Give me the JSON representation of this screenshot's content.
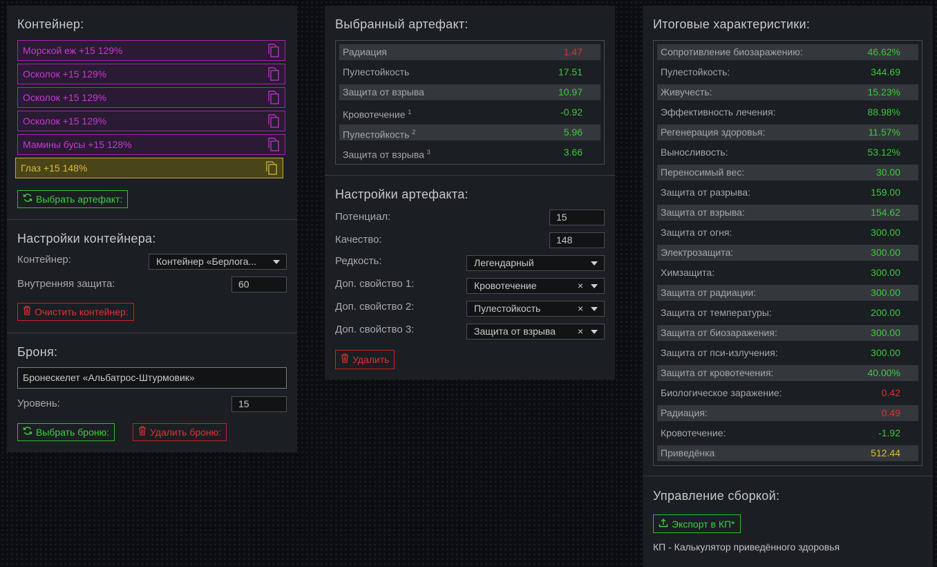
{
  "container": {
    "title": "Контейнер:",
    "slots": [
      "Морской еж +15 129%",
      "Осколок +15 129%",
      "Осколок +15 129%",
      "Осколок +15 129%",
      "Мамины бусы +15 128%"
    ],
    "gold_slot": "Глаз +15 148%",
    "select_artifact_label": "Выбрать артефакт:"
  },
  "container_settings": {
    "title": "Настройки контейнера:",
    "container_label": "Контейнер:",
    "container_value": "Контейнер «Берлога...",
    "inner_label": "Внутренняя защита:",
    "inner_value": "60",
    "clear_label": "Очистить контейнер:"
  },
  "armor": {
    "title": "Броня:",
    "name": "Бронескелет «Альбатрос-Штурмовик»",
    "level_label": "Уровень:",
    "level_value": "15",
    "choose_label": "Выбрать броню:",
    "delete_label": "Удалить броню:"
  },
  "selected": {
    "title": "Выбранный артефакт:",
    "rows": [
      {
        "name": "Радиация",
        "sup": "",
        "value": "1.47",
        "color": "red"
      },
      {
        "name": "Пулестойкость",
        "sup": "",
        "value": "17.51",
        "color": "green"
      },
      {
        "name": "Защита от взрыва",
        "sup": "",
        "value": "10.97",
        "color": "green"
      },
      {
        "name": "Кровотечение",
        "sup": "1",
        "value": "-0.92",
        "color": "green"
      },
      {
        "name": "Пулестойкость",
        "sup": "2",
        "value": "5.96",
        "color": "green"
      },
      {
        "name": "Защита от взрыва",
        "sup": "3",
        "value": "3.66",
        "color": "green"
      }
    ]
  },
  "artifact_settings": {
    "title": "Настройки артефакта:",
    "potential_label": "Потенциал:",
    "potential_value": "15",
    "quality_label": "Качество:",
    "quality_value": "148",
    "rarity_label": "Редкость:",
    "rarity_value": "Легендарный",
    "prop1_label": "Доп. свойство 1:",
    "prop1_value": "Кровотечение",
    "prop2_label": "Доп. свойство 2:",
    "prop2_value": "Пулестойкость",
    "prop3_label": "Доп. свойство 3:",
    "prop3_value": "Защита от взрыва",
    "clear_symbol": "×",
    "delete_label": "Удалить"
  },
  "totals": {
    "title": "Итоговые характеристики:",
    "rows": [
      {
        "name": "Сопротивление биозаражению:",
        "value": "46.62%",
        "color": "green"
      },
      {
        "name": "Пулестойкость:",
        "value": "344.69",
        "color": "green"
      },
      {
        "name": "Живучесть:",
        "value": "15.23%",
        "color": "green"
      },
      {
        "name": "Эффективность лечения:",
        "value": "88.98%",
        "color": "green"
      },
      {
        "name": "Регенерация здоровья:",
        "value": "11.57%",
        "color": "green"
      },
      {
        "name": "Выносливость:",
        "value": "53.12%",
        "color": "green"
      },
      {
        "name": "Переносимый вес:",
        "value": "30.00",
        "color": "green"
      },
      {
        "name": "Защита от разрыва:",
        "value": "159.00",
        "color": "green"
      },
      {
        "name": "Защита от взрыва:",
        "value": "154.62",
        "color": "green"
      },
      {
        "name": "Защита от огня:",
        "value": "300.00",
        "color": "green"
      },
      {
        "name": "Электрозащита:",
        "value": "300.00",
        "color": "green"
      },
      {
        "name": "Химзащита:",
        "value": "300.00",
        "color": "green"
      },
      {
        "name": "Защита от радиации:",
        "value": "300.00",
        "color": "green"
      },
      {
        "name": "Защита от температуры:",
        "value": "200.00",
        "color": "green"
      },
      {
        "name": "Защита от биозаражения:",
        "value": "300.00",
        "color": "green"
      },
      {
        "name": "Защита от пси-излучения:",
        "value": "300.00",
        "color": "green"
      },
      {
        "name": "Защита от кровотечения:",
        "value": "40.00%",
        "color": "green"
      },
      {
        "name": "Биологическое заражение:",
        "value": "0.42",
        "color": "red"
      },
      {
        "name": "Радиация:",
        "value": "0.49",
        "color": "red"
      },
      {
        "name": "Кровотечение:",
        "value": "-1.92",
        "color": "green"
      },
      {
        "name": "Приведёнка",
        "value": "512.44",
        "color": "gold"
      }
    ]
  },
  "build": {
    "title": "Управление сборкой:",
    "export_label": "Экспорт в КП*",
    "note": "КП - Калькулятор приведённого здоровья"
  }
}
